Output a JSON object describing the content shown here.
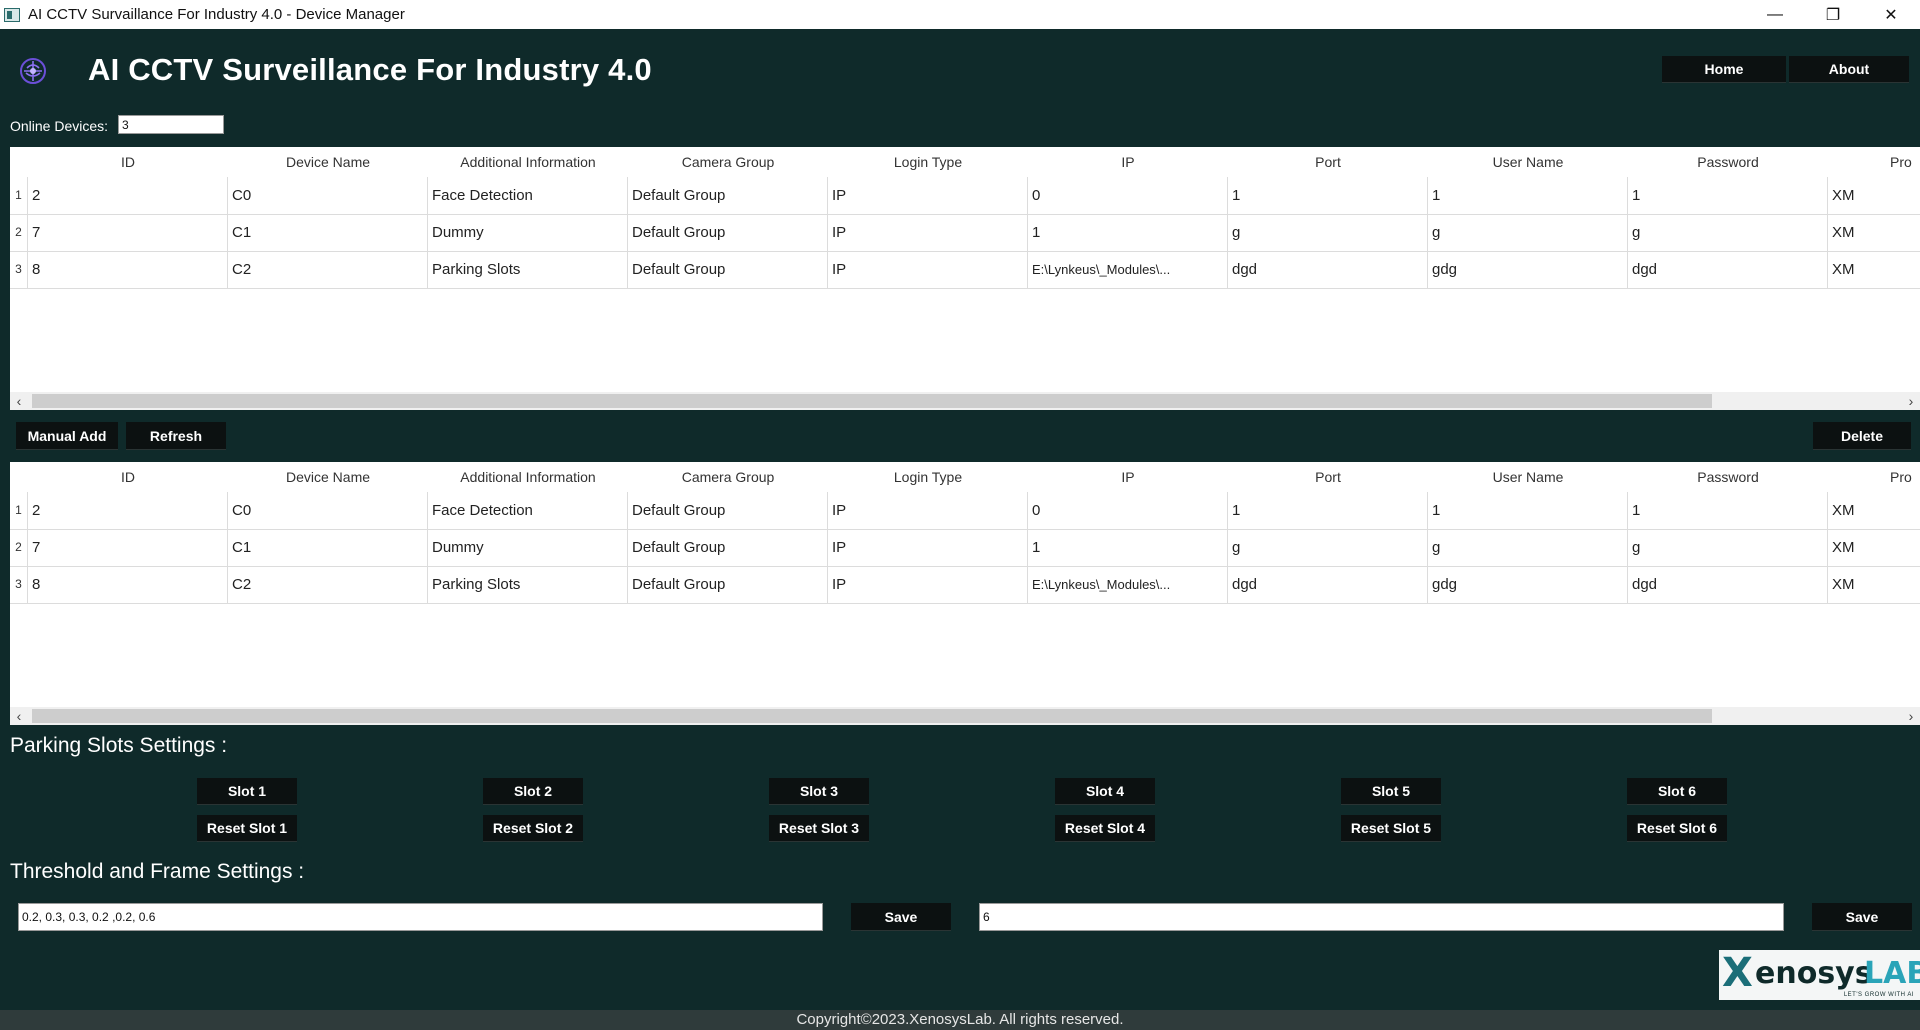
{
  "window": {
    "title": "AI CCTV Survaillance For Industry 4.0 - Device Manager",
    "minimize": "—",
    "restore": "❐",
    "close": "✕"
  },
  "header": {
    "title": "AI CCTV Surveillance For Industry 4.0",
    "home_label": "Home",
    "about_label": "About",
    "logo_icon": "brain-icon"
  },
  "online": {
    "label": "Online Devices:",
    "value": "3"
  },
  "tables": [
    {
      "columns": [
        "ID",
        "Device Name",
        "Additional Information",
        "Camera Group",
        "Login Type",
        "IP",
        "Port",
        "User Name",
        "Password",
        "Pro"
      ],
      "rows": [
        {
          "num": "1",
          "cells": [
            "2",
            "C0",
            "Face Detection",
            "Default Group",
            "IP",
            "0",
            "1",
            "1",
            "1",
            "XM"
          ]
        },
        {
          "num": "2",
          "cells": [
            "7",
            "C1",
            "Dummy",
            "Default Group",
            "IP",
            "1",
            "g",
            "g",
            "g",
            "XM"
          ]
        },
        {
          "num": "3",
          "cells": [
            "8",
            "C2",
            "Parking Slots",
            "Default Group",
            "IP",
            "E:\\Lynkeus\\_Modules\\...",
            "dgd",
            "gdg",
            "dgd",
            "XM"
          ]
        }
      ]
    },
    {
      "columns": [
        "ID",
        "Device Name",
        "Additional Information",
        "Camera Group",
        "Login Type",
        "IP",
        "Port",
        "User Name",
        "Password",
        "Pro"
      ],
      "rows": [
        {
          "num": "1",
          "cells": [
            "2",
            "C0",
            "Face Detection",
            "Default Group",
            "IP",
            "0",
            "1",
            "1",
            "1",
            "XM"
          ]
        },
        {
          "num": "2",
          "cells": [
            "7",
            "C1",
            "Dummy",
            "Default Group",
            "IP",
            "1",
            "g",
            "g",
            "g",
            "XM"
          ]
        },
        {
          "num": "3",
          "cells": [
            "8",
            "C2",
            "Parking Slots",
            "Default Group",
            "IP",
            "E:\\Lynkeus\\_Modules\\...",
            "dgd",
            "gdg",
            "dgd",
            "XM"
          ]
        }
      ]
    }
  ],
  "scroll": {
    "left": "‹",
    "right": "›"
  },
  "actions": {
    "manual_add": "Manual Add",
    "refresh": "Refresh",
    "delete": "Delete"
  },
  "parking": {
    "title": "Parking Slots Settings :",
    "slots": [
      "Slot 1",
      "Slot 2",
      "Slot 3",
      "Slot 4",
      "Slot 5",
      "Slot 6"
    ],
    "resets": [
      "Reset Slot 1",
      "Reset Slot 2",
      "Reset Slot 3",
      "Reset Slot 4",
      "Reset Slot 5",
      "Reset Slot 6"
    ]
  },
  "threshold": {
    "title": "Threshold and Frame Settings :",
    "threshold_value": "0.2, 0.3, 0.3, 0.2 ,0.2, 0.6",
    "frame_value": "6",
    "save_label": "Save"
  },
  "brand": {
    "x": "X",
    "mid": "enosys",
    "lab": "LAB",
    "tagline": "LET'S GROW WITH AI"
  },
  "footer": {
    "copyright": "Copyright©2023.XenosysLab. All rights reserved."
  },
  "colors": {
    "background": "#0f2a2a",
    "button": "#0c1111",
    "footer": "#2f3b3b"
  }
}
